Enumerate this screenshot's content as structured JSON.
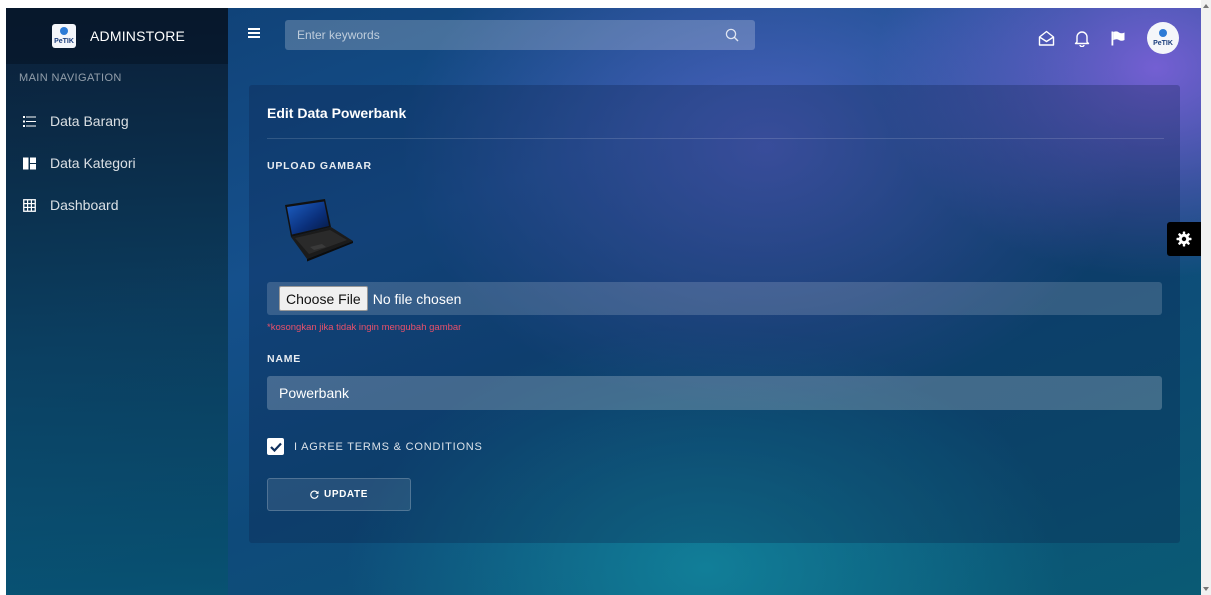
{
  "brand": {
    "name": "ADMINSTORE",
    "logo_text": "PeTIK"
  },
  "sidebar": {
    "header": "MAIN NAVIGATION",
    "items": [
      {
        "label": "Data Barang",
        "icon": "list-icon"
      },
      {
        "label": "Data Kategori",
        "icon": "view-quilt-icon"
      },
      {
        "label": "Dashboard",
        "icon": "grid-icon"
      }
    ]
  },
  "topbar": {
    "search_placeholder": "Enter keywords",
    "icons": [
      "mail-open-icon",
      "bell-icon",
      "flag-icon"
    ],
    "avatar_text": "PeTIK"
  },
  "form": {
    "title": "Edit Data Powerbank",
    "upload_label": "UPLOAD GAMBAR",
    "choose_file_label": "Choose File",
    "file_status": "No file chosen",
    "upload_hint": "*kosongkan jika tidak ingin mengubah gambar",
    "name_label": "NAME",
    "name_value": "Powerbank",
    "agree_label": "I AGREE TERMS & CONDITIONS",
    "agree_checked": true,
    "update_label": "UPDATE"
  },
  "colors": {
    "hint": "#e8506a",
    "settings_tab": "#000000"
  }
}
